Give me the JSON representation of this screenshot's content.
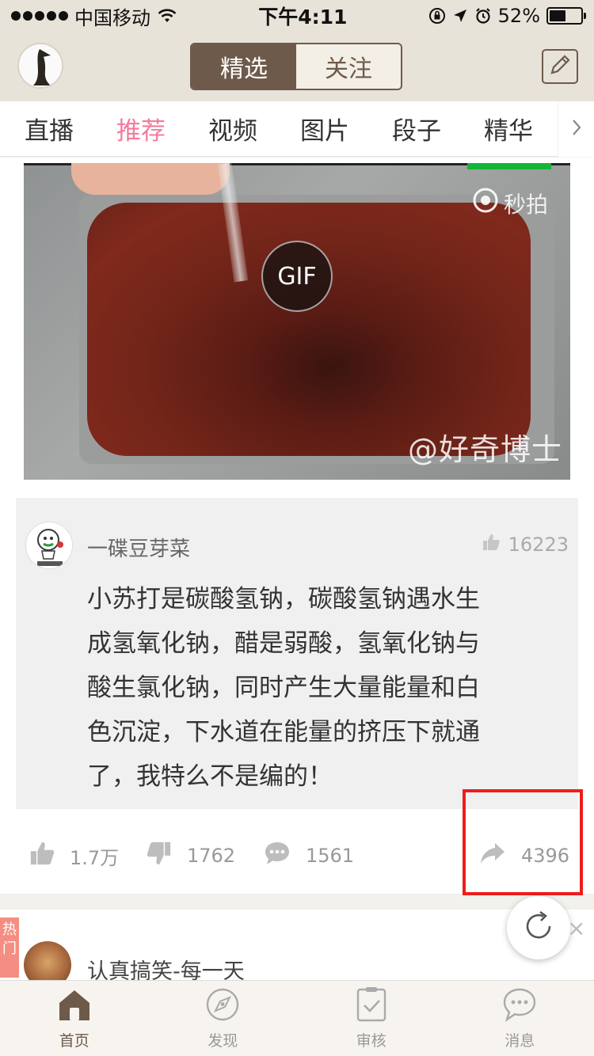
{
  "status_bar": {
    "carrier": "中国移动",
    "time": "下午4:11",
    "battery": "52%",
    "battery_level": 0.52
  },
  "header": {
    "segments": [
      "精选",
      "关注"
    ],
    "active_segment": "精选"
  },
  "tabs": {
    "items": [
      "直播",
      "推荐",
      "视频",
      "图片",
      "段子",
      "精华"
    ],
    "active": "推荐"
  },
  "post": {
    "gif_label": "GIF",
    "miaopai_watermark": "秒拍",
    "source_watermark": "@好奇博士",
    "comment": {
      "username": "一碟豆芽菜",
      "likes": "16223",
      "text": "小苏打是碳酸氢钠，碳酸氢钠遇水生\n成氢氧化钠，醋是弱酸，氢氧化钠与\n酸生氯化钠，同时产生大量能量和白\n色沉淀，下水道在能量的挤压下就通\n了，我特么不是编的！"
    },
    "actions": {
      "likes": "1.7万",
      "dislikes": "1762",
      "comments": "1561",
      "shares": "4396"
    }
  },
  "next_item": {
    "hot_tag": "热门",
    "username": "认真搞笑-每一天"
  },
  "refresh_close": "×",
  "bottom_nav": {
    "items": [
      "首页",
      "发现",
      "审核",
      "消息"
    ],
    "active": "首页"
  },
  "colors": {
    "accent": "#6e5a4b",
    "tab_active": "#f47a9b",
    "highlight": "#ee1c1c"
  }
}
